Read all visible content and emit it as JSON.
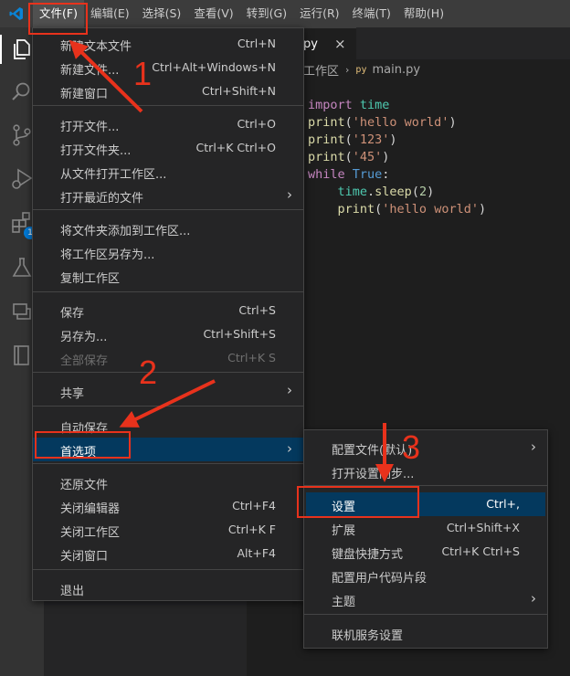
{
  "menubar": {
    "items": [
      {
        "label": "文件(F)"
      },
      {
        "label": "编辑(E)"
      },
      {
        "label": "选择(S)"
      },
      {
        "label": "查看(V)"
      },
      {
        "label": "转到(G)"
      },
      {
        "label": "运行(R)"
      },
      {
        "label": "终端(T)"
      },
      {
        "label": "帮助(H)"
      }
    ]
  },
  "activity_bar": {
    "icons": [
      "files-icon",
      "search-icon",
      "source-control-icon",
      "run-debug-icon",
      "extensions-icon",
      "testing-icon",
      "remote-explorer-icon",
      "notebook-icon"
    ],
    "extensions_badge": "1"
  },
  "editor": {
    "tab_label": "py",
    "tab_close": "×",
    "breadcrumb_workspace": "工作区",
    "breadcrumb_file_icon": "py",
    "breadcrumb_file": "main.py",
    "code": [
      {
        "parts": [
          {
            "t": "import",
            "c": "kw"
          },
          {
            "t": " ",
            "c": "plain"
          },
          {
            "t": "time",
            "c": "mod"
          }
        ]
      },
      {
        "parts": [
          {
            "t": "print",
            "c": "fn"
          },
          {
            "t": "(",
            "c": "plain"
          },
          {
            "t": "'hello world'",
            "c": "str"
          },
          {
            "t": ")",
            "c": "plain"
          }
        ]
      },
      {
        "parts": [
          {
            "t": "print",
            "c": "fn"
          },
          {
            "t": "(",
            "c": "plain"
          },
          {
            "t": "'123'",
            "c": "str"
          },
          {
            "t": ")",
            "c": "plain"
          }
        ]
      },
      {
        "parts": [
          {
            "t": "print",
            "c": "fn"
          },
          {
            "t": "(",
            "c": "plain"
          },
          {
            "t": "'45'",
            "c": "str"
          },
          {
            "t": ")",
            "c": "plain"
          }
        ]
      },
      {
        "parts": [
          {
            "t": "while",
            "c": "kw"
          },
          {
            "t": " ",
            "c": "plain"
          },
          {
            "t": "True",
            "c": "kw2"
          },
          {
            "t": ":",
            "c": "plain"
          }
        ]
      },
      {
        "parts": [
          {
            "t": "    ",
            "c": "plain"
          },
          {
            "t": "time",
            "c": "mod"
          },
          {
            "t": ".",
            "c": "plain"
          },
          {
            "t": "sleep",
            "c": "fn"
          },
          {
            "t": "(",
            "c": "plain"
          },
          {
            "t": "2",
            "c": "num"
          },
          {
            "t": ")",
            "c": "plain"
          }
        ]
      },
      {
        "parts": [
          {
            "t": "    ",
            "c": "plain"
          },
          {
            "t": "print",
            "c": "fn"
          },
          {
            "t": "(",
            "c": "plain"
          },
          {
            "t": "'hello world'",
            "c": "str"
          },
          {
            "t": ")",
            "c": "plain"
          }
        ]
      }
    ]
  },
  "file_menu": {
    "items": [
      {
        "label": "新建文本文件",
        "shortcut": "Ctrl+N"
      },
      {
        "label": "新建文件...",
        "shortcut": "Ctrl+Alt+Windows+N"
      },
      {
        "label": "新建窗口",
        "shortcut": "Ctrl+Shift+N"
      },
      {
        "label": "打开文件...",
        "shortcut": "Ctrl+O"
      },
      {
        "label": "打开文件夹...",
        "shortcut": "Ctrl+K Ctrl+O"
      },
      {
        "label": "从文件打开工作区...",
        "shortcut": ""
      },
      {
        "label": "打开最近的文件",
        "shortcut": ""
      },
      {
        "label": "将文件夹添加到工作区...",
        "shortcut": ""
      },
      {
        "label": "将工作区另存为...",
        "shortcut": ""
      },
      {
        "label": "复制工作区",
        "shortcut": ""
      },
      {
        "label": "保存",
        "shortcut": "Ctrl+S"
      },
      {
        "label": "另存为...",
        "shortcut": "Ctrl+Shift+S"
      },
      {
        "label": "全部保存",
        "shortcut": "Ctrl+K S"
      },
      {
        "label": "共享",
        "shortcut": ""
      },
      {
        "label": "自动保存",
        "shortcut": ""
      },
      {
        "label": "首选项",
        "shortcut": ""
      },
      {
        "label": "还原文件",
        "shortcut": ""
      },
      {
        "label": "关闭编辑器",
        "shortcut": "Ctrl+F4"
      },
      {
        "label": "关闭工作区",
        "shortcut": "Ctrl+K F"
      },
      {
        "label": "关闭窗口",
        "shortcut": "Alt+F4"
      },
      {
        "label": "退出",
        "shortcut": ""
      }
    ],
    "submenu_arrow": "›"
  },
  "pref_menu": {
    "items": [
      {
        "label": "配置文件(默认)",
        "shortcut": ""
      },
      {
        "label": "打开设置同步...",
        "shortcut": ""
      },
      {
        "label": "设置",
        "shortcut": "Ctrl+,"
      },
      {
        "label": "扩展",
        "shortcut": "Ctrl+Shift+X"
      },
      {
        "label": "键盘快捷方式",
        "shortcut": "Ctrl+K Ctrl+S"
      },
      {
        "label": "配置用户代码片段",
        "shortcut": ""
      },
      {
        "label": "主题",
        "shortcut": ""
      },
      {
        "label": "联机服务设置",
        "shortcut": ""
      }
    ]
  },
  "annotations": {
    "step1": "1",
    "step2": "2",
    "step3": "3",
    "color": "#e8321c"
  },
  "colors": {
    "menubar_bg": "#3c3c3c",
    "menu_bg": "#252526",
    "highlight_bg": "#04395e",
    "editor_bg": "#1e1e1e",
    "accent_blue": "#0078d4"
  }
}
